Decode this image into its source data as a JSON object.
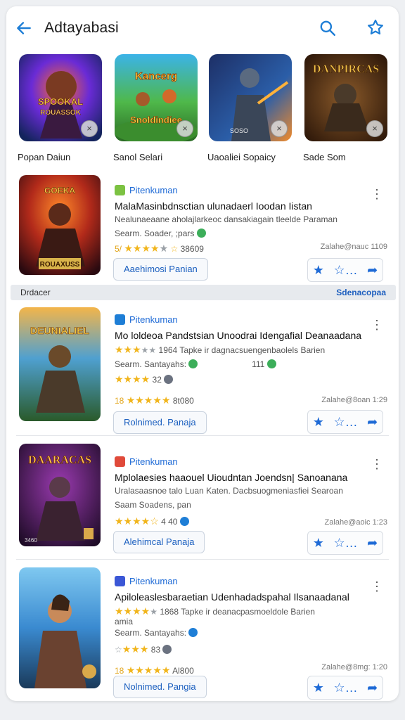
{
  "header": {
    "title": "Adtayabasi",
    "back_icon": "arrow-left-icon",
    "search_icon": "search-icon",
    "favorite_icon": "star-icon"
  },
  "top_row": [
    {
      "caption": "Popan Daiun",
      "art_text": "SPOOKAL ROUASSOK"
    },
    {
      "caption": "Sanol Selari",
      "art_text": "Kancerg Snoldindiee"
    },
    {
      "caption": "Uaoaliei Sopaicy",
      "art_text": "SOSO"
    },
    {
      "caption": "Sade Som",
      "art_text": "DANPIRCAS"
    }
  ],
  "band": {
    "left": "Drdacer",
    "right": "Sdenacopaa"
  },
  "items": [
    {
      "tag": "Pitenkuman",
      "tag_color": "#7cc242",
      "title": "MalaMasinbdnsctian ulunadaerl Ioodan Iistan",
      "subtitle": "Nealunaeaane aholajlarkeoc dansakiagain tleelde Paraman",
      "line3": "Searm. Soader, ;pars",
      "rating_prefix": "5/",
      "rating_count": "38609",
      "right_meta": "Zalahe@nauc 1109",
      "button": "Aaehimosi Panian",
      "art_text": "ROUAXUSS"
    },
    {
      "tag": "Pitenkuman",
      "tag_color": "#1e7ed6",
      "title": "Mo loldeoa Pandstsian Unoodrai Idengafial Deanaadana",
      "subtitle": "1964 Tapke ir dagnacsuengenbaolels Barien",
      "line3": "Searm. Santayahs:",
      "line3_count": "111",
      "line4": "32",
      "rating_prefix": "18",
      "rating_count": "8t080",
      "right_meta": "Zalahe@8oan 1:29",
      "button": "Rolnimed. Panaja",
      "art_text": "DEUNIALIEL"
    },
    {
      "tag": "Pitenkuman",
      "tag_color": "#e04a3a",
      "title": "Mplolaesies haaouel Uioudntan Joendsn| Sanoanana",
      "subtitle": "Uralasaasnoe talo Luan Katen. Dacbsuogmeniasfiei Searoan",
      "line3": "Saam Soadens, pan",
      "rating_count": "4 40",
      "right_meta": "Zalahe@aoic 1:23",
      "button": "Alehimcal Panaja",
      "art_text": "DAARACAS",
      "art_badge": "3460"
    },
    {
      "tag": "Pitenkuman",
      "tag_color": "#3b57d6",
      "title": "Apiloleaslesbaraetian Udenhadadspahal Ilsanaadanal",
      "subtitle": "1868 Tapke ir deanacpasmoeldole Barien",
      "subtitle2": "amia",
      "line3": "Searm. Santayahs:",
      "line4": "83",
      "rating_prefix": "18",
      "rating_count": "Al800",
      "right_meta": "Zalahe@8mg: 1:20",
      "button": "Nolnimed. Pangia",
      "art_text": ""
    }
  ],
  "colors": {
    "accent": "#1e7ed6",
    "star": "#f1b51c"
  }
}
